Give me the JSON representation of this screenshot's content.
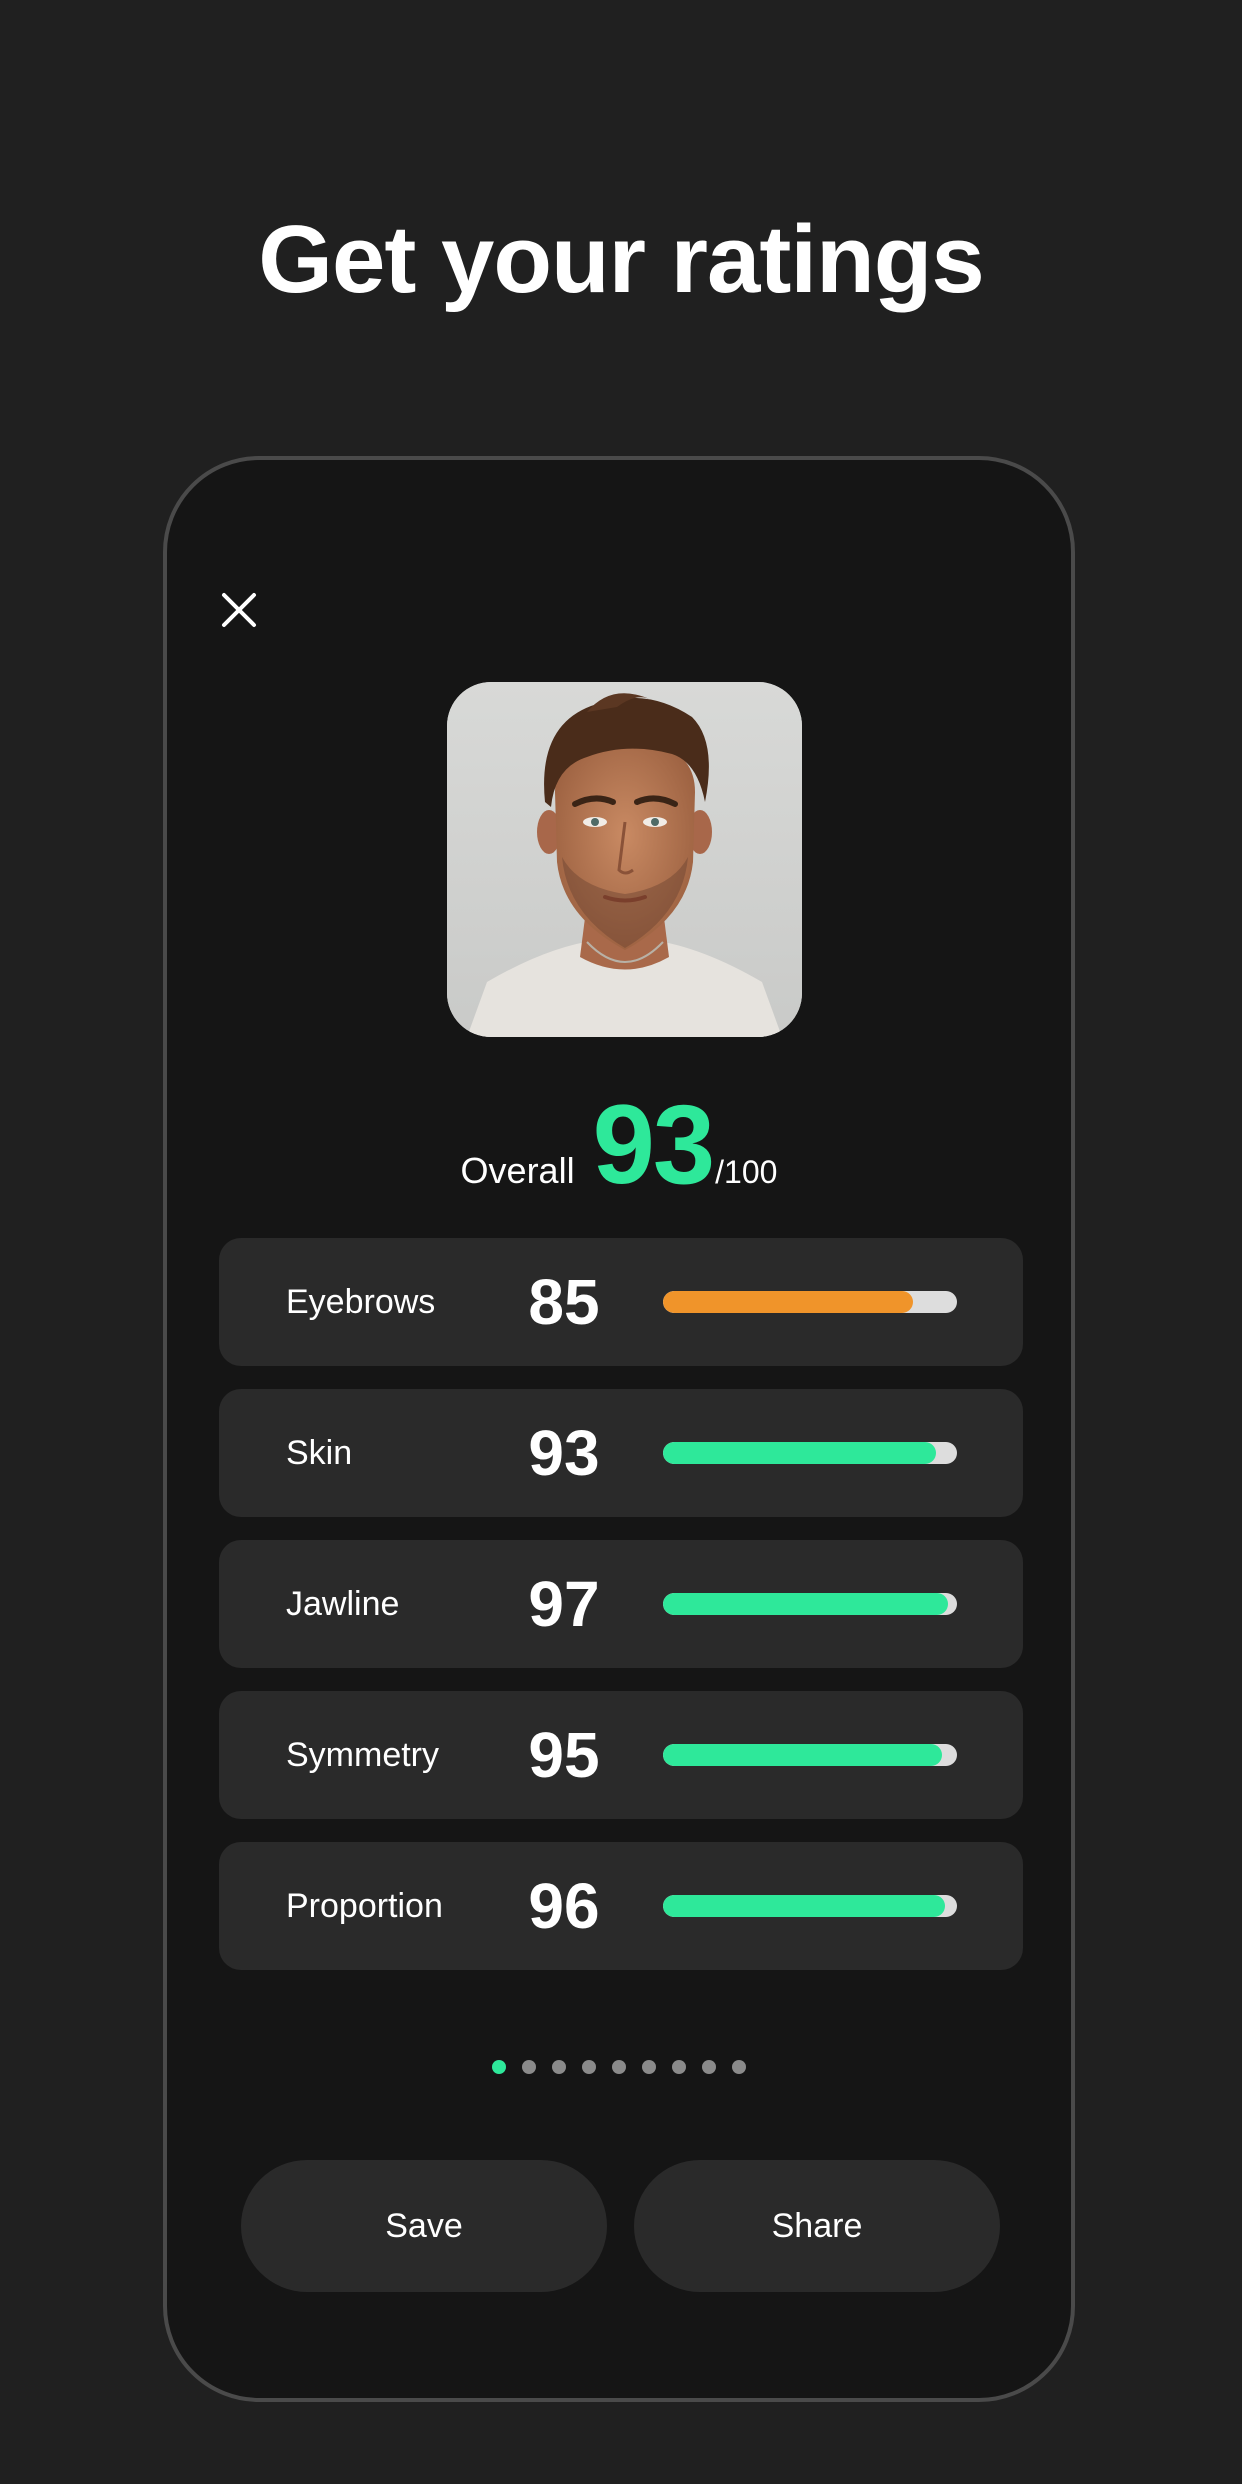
{
  "headline": "Get your ratings",
  "icons": {
    "close": "close-icon",
    "photo": "portrait-photo"
  },
  "overall": {
    "label": "Overall",
    "score": "93",
    "max": "/100"
  },
  "colors": {
    "green": "#2ee89a",
    "orange": "#f0942a",
    "track": "#dddddd"
  },
  "ratings": [
    {
      "name": "Eyebrows",
      "value": 85,
      "color": "#f0942a"
    },
    {
      "name": "Skin",
      "value": 93,
      "color": "#2ee89a"
    },
    {
      "name": "Jawline",
      "value": 97,
      "color": "#2ee89a"
    },
    {
      "name": "Symmetry",
      "value": 95,
      "color": "#2ee89a"
    },
    {
      "name": "Proportion",
      "value": 96,
      "color": "#2ee89a"
    }
  ],
  "pagination": {
    "total": 9,
    "active": 0
  },
  "buttons": {
    "save": "Save",
    "share": "Share"
  }
}
